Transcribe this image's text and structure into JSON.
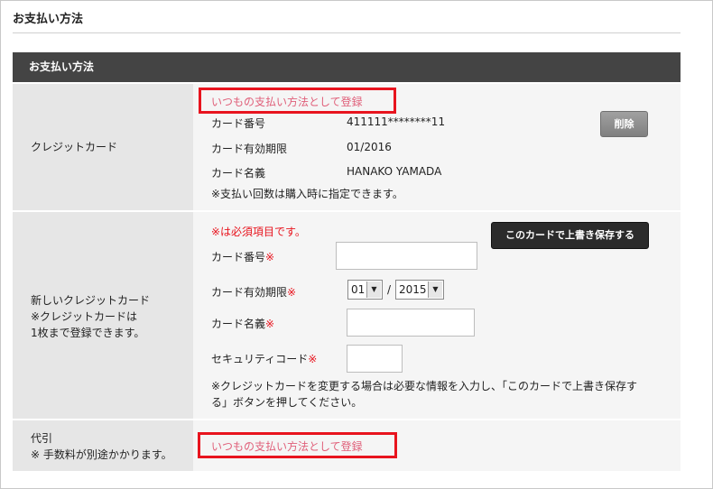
{
  "page": {
    "title": "お支払い方法",
    "section_header": "お支払い方法"
  },
  "credit_card_row": {
    "label": "クレジットカード",
    "register_link": "いつもの支払い方法として登録",
    "card_number_label": "カード番号",
    "card_number_value": "411111********11",
    "expiry_label": "カード有効期限",
    "expiry_value": "01/2016",
    "name_label": "カード名義",
    "name_value": "HANAKO YAMADA",
    "note": "※支払い回数は購入時に指定できます。",
    "delete_button": "削除"
  },
  "new_card_row": {
    "label_line1": "新しいクレジットカード",
    "label_line2": "※クレジットカードは",
    "label_line3": "1枚まで登録できます。",
    "required_note": "※は必須項目です。",
    "save_button": "このカードで上書き保存する",
    "card_number_label": "カード番号",
    "expiry_label": "カード有効期限",
    "expiry_month": "01",
    "expiry_separator": "/",
    "expiry_year": "2015",
    "name_label": "カード名義",
    "security_label": "セキュリティコード",
    "required_mark": "※",
    "note_line1": "※クレジットカードを変更する場合は必要な情報を入力し、「このカードで上書き保存す",
    "note_line2": "る」ボタンを押してください。"
  },
  "cod_row": {
    "label_line1": "代引",
    "label_line2": "※ 手数料が別途かかります。",
    "register_link": "いつもの支払い方法として登録"
  },
  "colors": {
    "header_bg": "#444444",
    "label_bg": "#e6e6e6",
    "content_bg": "#f5f5f5",
    "link": "#e0607a",
    "highlight": "#e8141e"
  }
}
